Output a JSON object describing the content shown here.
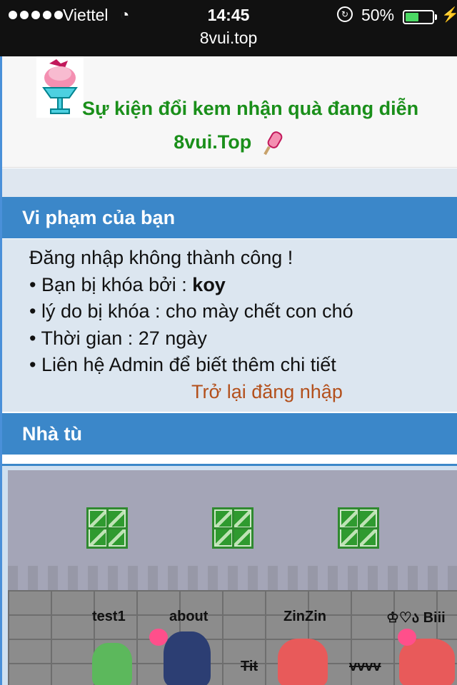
{
  "status_bar": {
    "carrier": "Viettel",
    "time": "14:45",
    "battery_percent": "50%",
    "battery_level": 0.5
  },
  "address_bar": {
    "url": "8vui.top"
  },
  "event_banner": {
    "text": "Sự kiện đổi kem nhận quà đang diễn",
    "site": "8vui.Top"
  },
  "violation": {
    "header": "Vi phạm của bạn",
    "login_failed": "Đăng nhập không thành công !",
    "locked_by_label": "• Bạn bị khóa bởi : ",
    "locked_by_name": "koy",
    "reason": "• lý do bị khóa : cho mày chết con chó",
    "duration": "• Thời gian : 27 ngày",
    "contact": "• Liên hệ Admin để biết thêm chi tiết",
    "back_link": "Trở lại đăng nhập"
  },
  "prison": {
    "header": "Nhà tù",
    "players": [
      "test1",
      "about",
      "ZinZin",
      "♔♡ა Biii",
      "Tit",
      "vvvv"
    ]
  },
  "colors": {
    "header_blue": "#3b87c9",
    "event_green": "#1a8f1a",
    "link_orange": "#b3501c"
  }
}
